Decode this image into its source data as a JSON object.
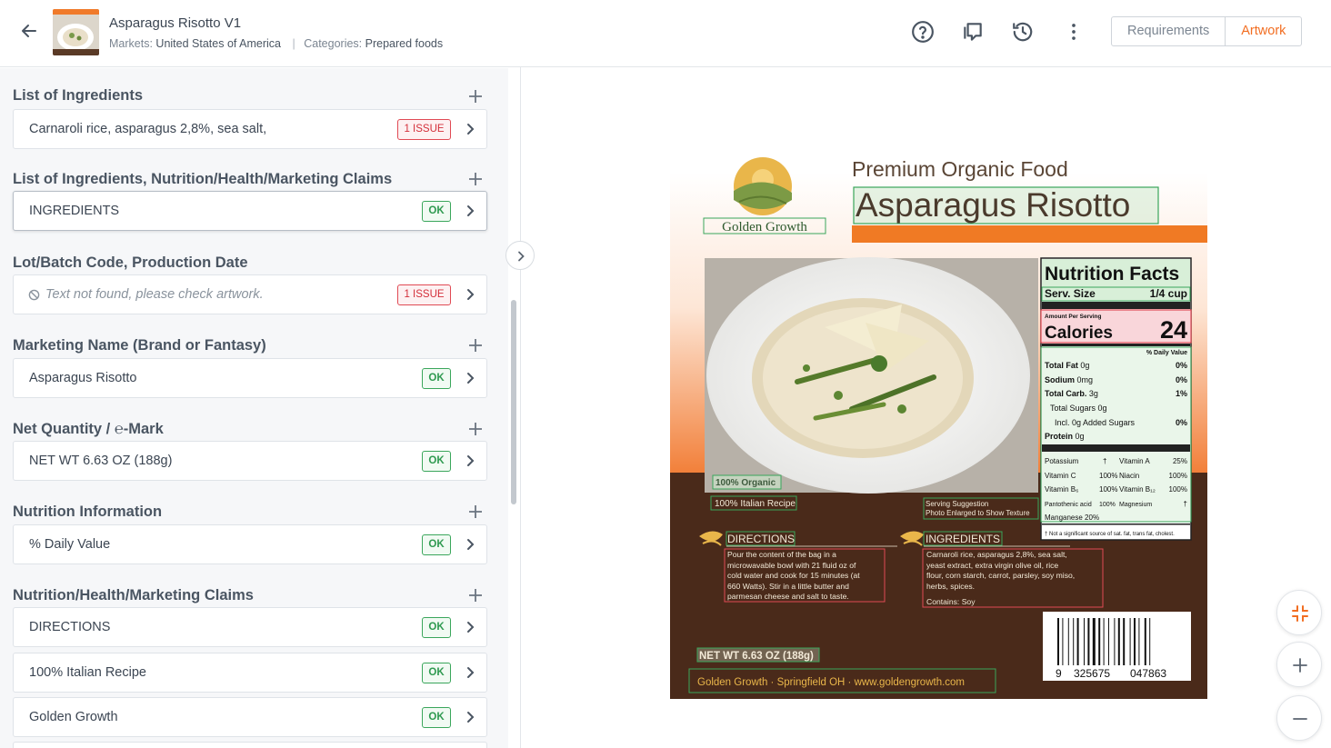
{
  "header": {
    "title": "Asparagus Risotto V1",
    "markets_label": "Markets:",
    "markets_value": "United States of America",
    "categories_label": "Categories:",
    "categories_value": "Prepared foods",
    "tabs": {
      "requirements": "Requirements",
      "artwork": "Artwork"
    },
    "active_tab": "Artwork",
    "accent_color": "#f26e22"
  },
  "sections": [
    {
      "title": "List of Ingredients",
      "items": [
        {
          "text": "Carnaroli rice, asparagus 2,8%, sea salt,",
          "status": "1 ISSUE"
        }
      ]
    },
    {
      "title": "List of Ingredients, Nutrition/Health/Marketing Claims",
      "items": [
        {
          "text": "INGREDIENTS",
          "status": "OK"
        }
      ]
    },
    {
      "title": "Lot/Batch Code, Production Date",
      "items": [
        {
          "text": "Text not found, please check artwork.",
          "status": "1 ISSUE"
        }
      ]
    },
    {
      "title": "Marketing Name (Brand or Fantasy)",
      "items": [
        {
          "text": "Asparagus Risotto",
          "status": "OK"
        }
      ]
    },
    {
      "title": "Net Quantity / ℮-Mark",
      "items": [
        {
          "text": "NET WT 6.63 OZ (188g)",
          "status": "OK"
        }
      ]
    },
    {
      "title": "Nutrition Information",
      "items": [
        {
          "text": "% Daily Value",
          "status": "OK"
        }
      ]
    },
    {
      "title": "Nutrition/Health/Marketing Claims",
      "items": [
        {
          "text": "DIRECTIONS",
          "status": "OK"
        },
        {
          "text": "100% Italian Recipe",
          "status": "OK"
        },
        {
          "text": "Golden Growth",
          "status": "OK"
        }
      ]
    }
  ],
  "artwork": {
    "brand": "Golden Growth",
    "tagline": "Premium Organic Food",
    "product_name": "Asparagus Risotto",
    "organic_badge": "100% Organic",
    "italian_recipe": "100% Italian Recipe",
    "serving_suggestion_1": "Serving Suggestion",
    "serving_suggestion_2": "Photo Enlarged to Show Texture",
    "directions_title": "DIRECTIONS",
    "directions_lines": [
      "Pour the content of the bag in a",
      "microwavable bowl with 21 fluid oz of",
      "cold water and cook for 15 minutes (at",
      "660 Watts). Stir in a little butter and",
      "parmesan cheese and salt to taste."
    ],
    "ingredients_title": "INGREDIENTS",
    "ingredients_lines": [
      "Carnaroli rice, asparagus 2,8%, sea salt,",
      "yeast extract, extra virgin olive oil, rice",
      "flour, corn starch, carrot, parsley, soy miso,",
      "herbs, spices."
    ],
    "contains": "Contains: Soy",
    "net_wt": "NET WT 6.63 OZ (188g)",
    "footer": "Golden Growth  ·  Springfield OH  ·  www.goldengrowth.com",
    "barcode_digits": [
      "9",
      "325675",
      "047863"
    ],
    "nutrition": {
      "title": "Nutrition Facts",
      "serv_label": "Serv. Size",
      "serv_value": "1/4 cup",
      "amount_per": "Amount Per Serving",
      "calories_label": "Calories",
      "calories_value": "24",
      "dv_header": "% Daily Value",
      "rows": [
        {
          "label": "Total Fat",
          "amt": "0g",
          "dv": "0%"
        },
        {
          "label": "Sodium",
          "amt": "0mg",
          "dv": "0%"
        },
        {
          "label": "Total Carb.",
          "amt": "3g",
          "dv": "1%"
        },
        {
          "label": "Total Sugars",
          "amt": "0g",
          "dv": ""
        },
        {
          "label": "Incl. 0g Added Sugars",
          "amt": "",
          "dv": "0%"
        },
        {
          "label": "Protein",
          "amt": "0g",
          "dv": ""
        }
      ],
      "vitamins": [
        [
          "Potassium",
          "†",
          "Vitamin A",
          "25%"
        ],
        [
          "Vitamin C",
          "100%",
          "Niacin",
          "100%"
        ],
        [
          "Vitamin B₆",
          "100%",
          "Vitamin B₁₂",
          "100%"
        ],
        [
          "Pantothenic acid",
          "100%",
          "Magnesium",
          "†"
        ],
        [
          "Manganese",
          "20%",
          "",
          ""
        ]
      ],
      "footnote": "† Not a significant source of sat. fat, trans fat, cholest."
    }
  }
}
